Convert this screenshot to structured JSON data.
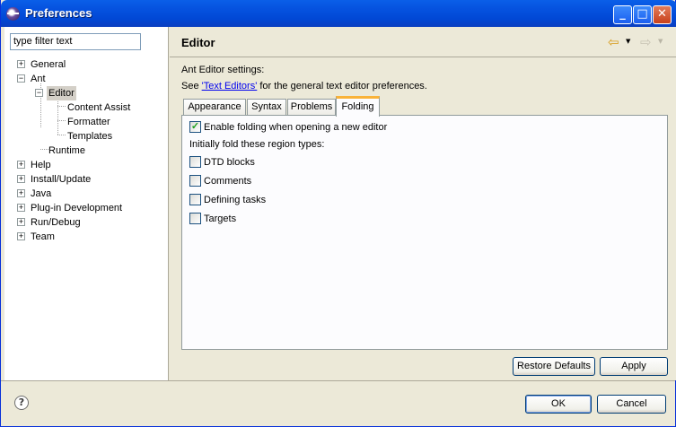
{
  "window": {
    "title": "Preferences",
    "minimize_glyph": "_",
    "maximize_glyph": "□",
    "close_glyph": "✕"
  },
  "filter": {
    "value": "type filter text"
  },
  "tree": {
    "items": [
      {
        "label": "General",
        "twisty": "+"
      },
      {
        "label": "Ant",
        "twisty": "−"
      },
      {
        "label": "Editor",
        "twisty": "−"
      },
      {
        "label": "Content Assist"
      },
      {
        "label": "Formatter"
      },
      {
        "label": "Templates"
      },
      {
        "label": "Runtime"
      },
      {
        "label": "Help",
        "twisty": "+"
      },
      {
        "label": "Install/Update",
        "twisty": "+"
      },
      {
        "label": "Java",
        "twisty": "+"
      },
      {
        "label": "Plug-in Development",
        "twisty": "+"
      },
      {
        "label": "Run/Debug",
        "twisty": "+"
      },
      {
        "label": "Team",
        "twisty": "+"
      }
    ]
  },
  "page": {
    "title": "Editor",
    "back_glyph": "⇦",
    "forward_glyph": "⇨",
    "dropdown_glyph": "▼",
    "settings_heading": "Ant Editor settings:",
    "see_prefix": "See ",
    "see_link": "'Text Editors'",
    "see_suffix": " for the general text editor preferences."
  },
  "tabs": [
    {
      "label": "Appearance"
    },
    {
      "label": "Syntax"
    },
    {
      "label": "Problems"
    },
    {
      "label": "Folding"
    }
  ],
  "folding": {
    "enable_label": "Enable folding when opening a new editor",
    "enable_checked_glyph": "✓",
    "region_heading": "Initially fold these region types:",
    "regions": [
      {
        "label": "DTD blocks"
      },
      {
        "label": "Comments"
      },
      {
        "label": "Defining tasks"
      },
      {
        "label": "Targets"
      }
    ]
  },
  "buttons": {
    "restore_defaults": "Restore Defaults",
    "apply": "Apply",
    "ok": "OK",
    "cancel": "Cancel"
  },
  "help": {
    "glyph": "?"
  }
}
